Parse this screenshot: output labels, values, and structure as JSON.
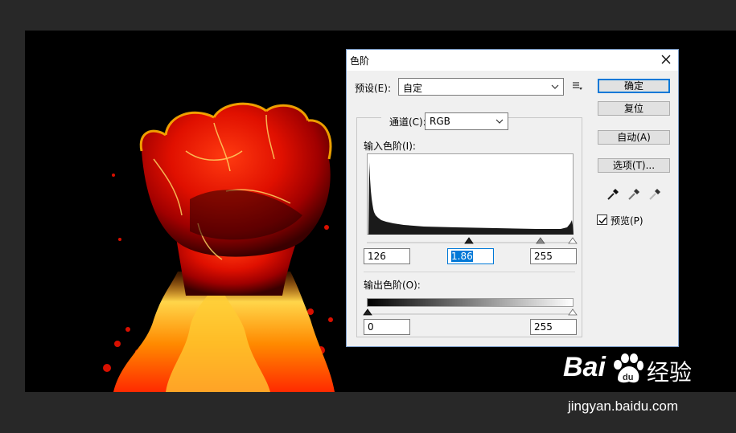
{
  "dialog": {
    "title": "色阶",
    "preset": {
      "label": "预设(E):",
      "value": "自定"
    },
    "channel": {
      "label": "通道(C):",
      "value": "RGB"
    },
    "input_levels": {
      "label": "输入色阶(I):",
      "black": "126",
      "gamma": "1.86",
      "white": "255"
    },
    "output_levels": {
      "label": "输出色阶(O):",
      "black": "0",
      "white": "255"
    },
    "buttons": {
      "ok": "确定",
      "reset": "复位",
      "auto": "自动(A)",
      "options": "选项(T)..."
    },
    "preview": {
      "label": "预览(P)",
      "checked": true
    },
    "eyedroppers": [
      "black-eyedropper-icon",
      "gray-eyedropper-icon",
      "white-eyedropper-icon"
    ],
    "sliders": {
      "input_black": 126,
      "input_gamma": 1.86,
      "input_white": 255,
      "output_black": 0,
      "output_white": 255
    }
  },
  "watermark": {
    "brand_left": "Bai",
    "brand_right": "经验",
    "url": "jingyan.baidu.com"
  },
  "colors": {
    "accent": "#0078d7",
    "canvas": "#000000",
    "workspace": "#282828"
  }
}
